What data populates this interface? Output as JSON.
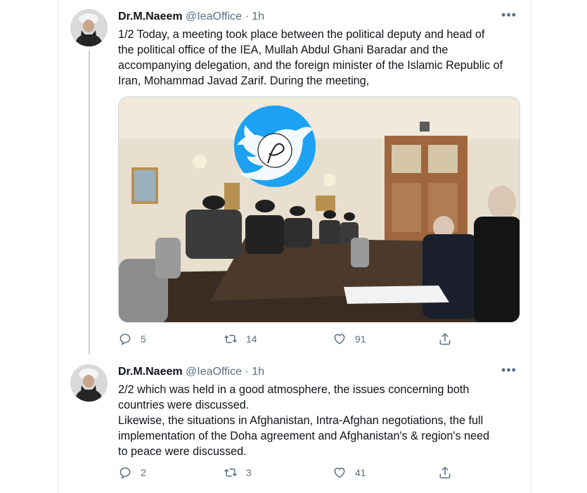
{
  "tweets": [
    {
      "author_name": "Dr.M.Naeem",
      "handle": "@IeaOffice",
      "separator": "·",
      "time": "1h",
      "text": "1/2 Today, a meeting took place between the political deputy and head of\nthe political office of the IEA, Mullah Abdul Ghani Baradar and the\naccompanying delegation, and the foreign minister of the Islamic Republic of\nIran, Mohammad Javad Zarif. During the meeting,",
      "replies": "5",
      "retweets": "14",
      "likes": "91",
      "has_media": true
    },
    {
      "author_name": "Dr.M.Naeem",
      "handle": "@IeaOffice",
      "separator": "·",
      "time": "1h",
      "text": "2/2 which was held in a good atmosphere, the issues concerning both\ncountries were discussed.\nLikewise, the situations in Afghanistan, Intra-Afghan negotiations, the full\nimplementation of the Doha agreement and Afghanistan's & region's need\nto peace were discussed.",
      "replies": "2",
      "retweets": "3",
      "likes": "41",
      "has_media": false
    }
  ],
  "more_label": "•••",
  "icons": [
    "reply-icon",
    "retweet-icon",
    "like-icon",
    "share-icon"
  ],
  "colors": {
    "muted": "#5b7083",
    "text": "#0f1419",
    "watermark": "#1da1f2"
  }
}
